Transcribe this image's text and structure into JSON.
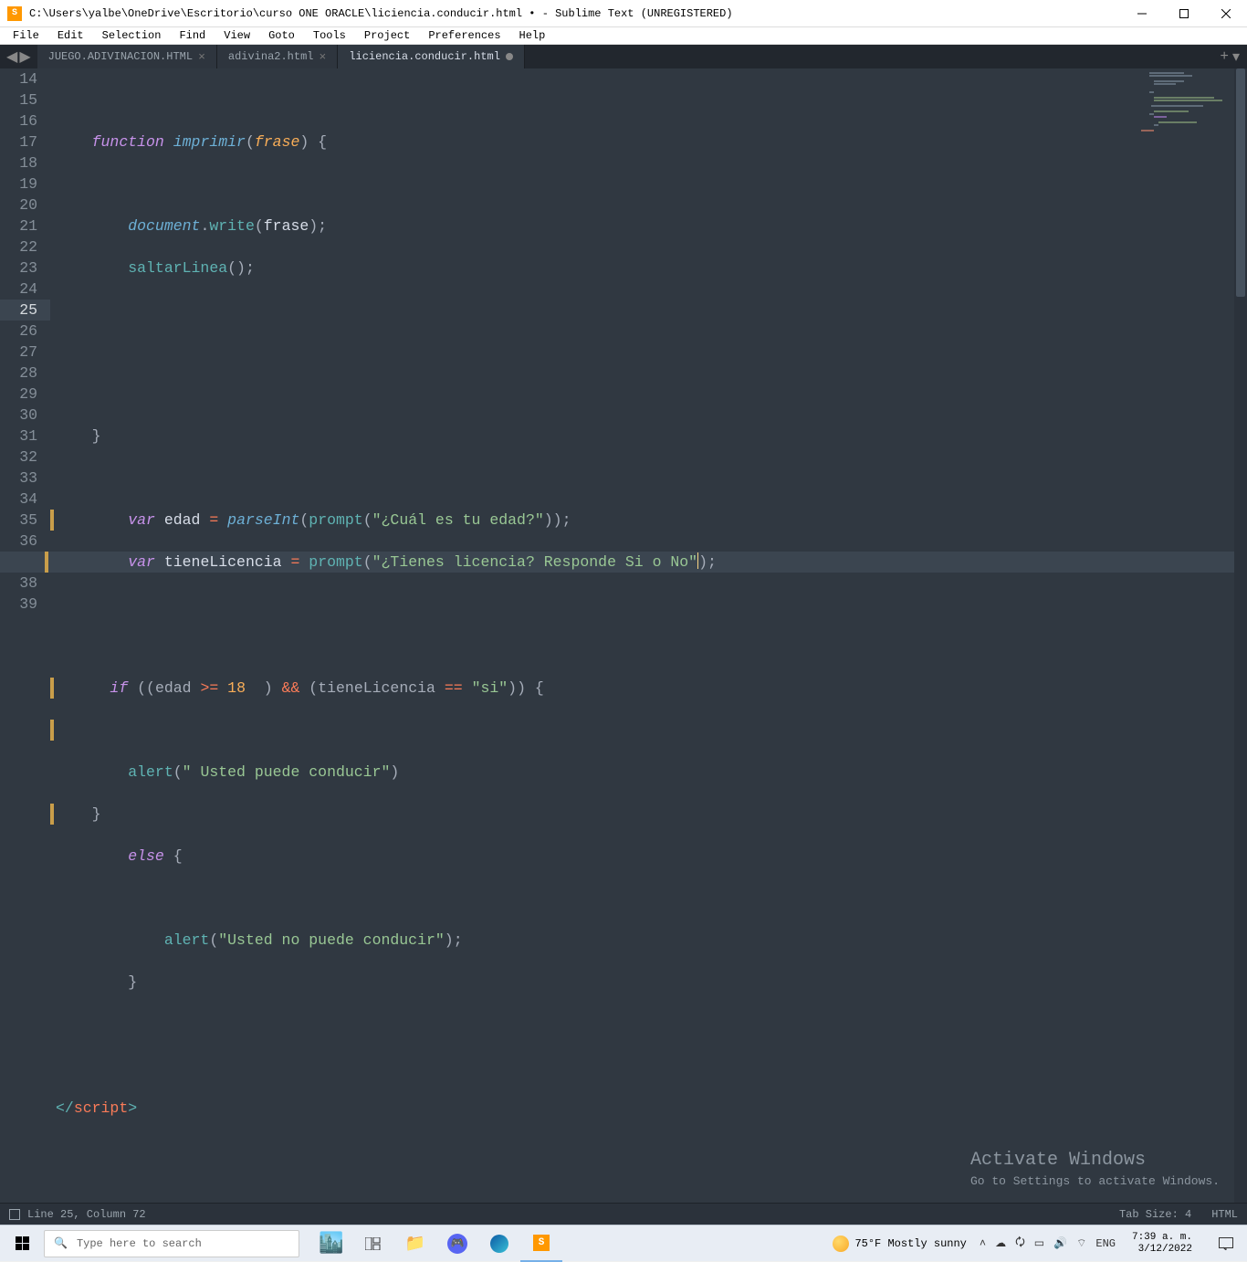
{
  "titlebar": {
    "text": "C:\\Users\\yalbe\\OneDrive\\Escritorio\\curso ONE ORACLE\\liciencia.conducir.html • - Sublime Text (UNREGISTERED)"
  },
  "menubar": {
    "items": [
      "File",
      "Edit",
      "Selection",
      "Find",
      "View",
      "Goto",
      "Tools",
      "Project",
      "Preferences",
      "Help"
    ]
  },
  "tabs": [
    {
      "label": "JUEGO.ADIVINACION.HTML",
      "active": false,
      "dirty": false
    },
    {
      "label": "adivina2.html",
      "active": false,
      "dirty": false
    },
    {
      "label": "liciencia.conducir.html",
      "active": true,
      "dirty": true
    }
  ],
  "gutter": {
    "start": 14,
    "end": 39,
    "active": 25,
    "modified": [
      24,
      25,
      28,
      29,
      31
    ]
  },
  "code": {
    "l14": "",
    "l15_kw": "function",
    "l15_fn": "imprimir",
    "l15_p1": "(",
    "l15_param": "frase",
    "l15_p2": ") {",
    "l16": "",
    "l17_obj": "document",
    "l17_dot": ".",
    "l17_call": "write",
    "l17_open": "(",
    "l17_arg": "frase",
    "l17_close": ");",
    "l18_call": "saltarLinea",
    "l18_p": "();",
    "l19": "",
    "l20": "",
    "l21": "",
    "l22": "}",
    "l23": "",
    "l24_var": "var",
    "l24_name": "edad",
    "l24_eq": " = ",
    "l24_fn": "parseInt",
    "l24_p1": "(",
    "l24_fn2": "prompt",
    "l24_p2": "(",
    "l24_str": "\"¿Cuál es tu edad?\"",
    "l24_p3": "));",
    "l25_var": "var",
    "l25_name": "tieneLicencia",
    "l25_eq": " = ",
    "l25_fn": "prompt",
    "l25_p1": "(",
    "l25_str": "\"¿Tienes licencia? Responde Si o No\"",
    "l25_p2": ");",
    "l26": "",
    "l27": "",
    "l28_if": "if",
    "l28_a": " ((edad ",
    "l28_op": ">=",
    "l28_b": " ",
    "l28_num": "18",
    "l28_c": "  ) ",
    "l28_and": "&&",
    "l28_d": " (tieneLicencia ",
    "l28_eq": "==",
    "l28_e": " ",
    "l28_str": "\"si\"",
    "l28_f": ")) {",
    "l29": "",
    "l30_call": "alert",
    "l30_p1": "(",
    "l30_str": "\" Usted puede conducir\"",
    "l30_p2": ")",
    "l31": "}",
    "l32_else": "else",
    "l32_b": " {",
    "l33": "",
    "l34_call": "alert",
    "l34_p1": "(",
    "l34_str": "\"Usted no puede conducir\"",
    "l34_p2": ");",
    "l35": "}",
    "l36": "",
    "l37": "",
    "l38_o": "</",
    "l38_t": "script",
    "l38_c": ">",
    "l39": ""
  },
  "watermark": {
    "title": "Activate Windows",
    "sub": "Go to Settings to activate Windows."
  },
  "statusbar": {
    "pos": "Line 25, Column 72",
    "tabsize": "Tab Size: 4",
    "lang": "HTML"
  },
  "taskbar": {
    "search_placeholder": "Type here to search",
    "weather": "75°F  Mostly sunny",
    "lang": "ENG",
    "time": "7:39 a. m.",
    "date": "3/12/2022"
  }
}
